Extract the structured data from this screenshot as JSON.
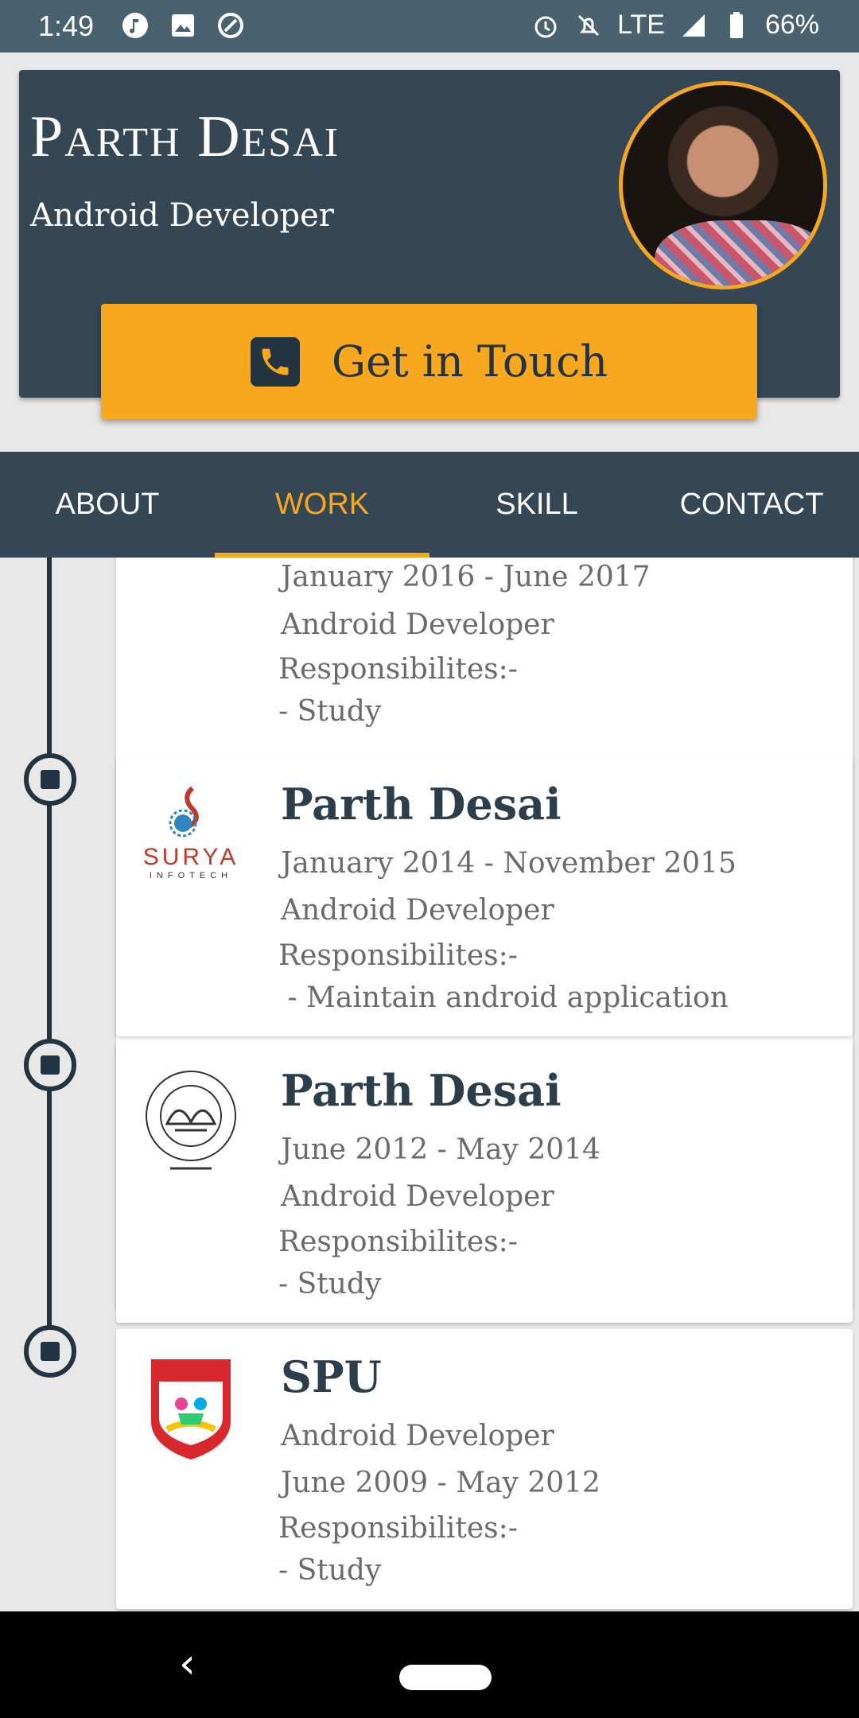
{
  "status_bar": {
    "time": "1:49",
    "network": "LTE",
    "battery": "66%"
  },
  "profile": {
    "name": "Parth Desai",
    "role": "Android Developer",
    "touch_label": "Get in Touch",
    "accent": "#f7a81e",
    "header_bg": "#354654"
  },
  "tabs": [
    {
      "label": "ABOUT"
    },
    {
      "label": "WORK"
    },
    {
      "label": "SKILL"
    },
    {
      "label": "CONTACT"
    }
  ],
  "work": [
    {
      "date": "January 2016 - June 2017",
      "role": "Android Developer",
      "resp_label": "Responsibilites:-",
      "resp": "- Study"
    },
    {
      "title": "Parth Desai",
      "date": "January 2014 - November 2015",
      "role": "Android Developer",
      "resp_label": "Responsibilites:-",
      "resp": " - Maintain android application",
      "logo_text": "SURYA",
      "logo_sub": "INFOTECH"
    },
    {
      "title": "Parth Desai",
      "date": "June 2012 - May 2014",
      "role": "Android Developer",
      "resp_label": "Responsibilites:-",
      "resp": "- Study",
      "logo_icon": "msu-baroda-seal-icon"
    },
    {
      "title": "SPU",
      "role": "Android Developer",
      "date": "June 2009 - May 2012",
      "resp_label": "Responsibilites:-",
      "resp": "- Study",
      "logo_icon": "spu-shield-icon"
    }
  ]
}
